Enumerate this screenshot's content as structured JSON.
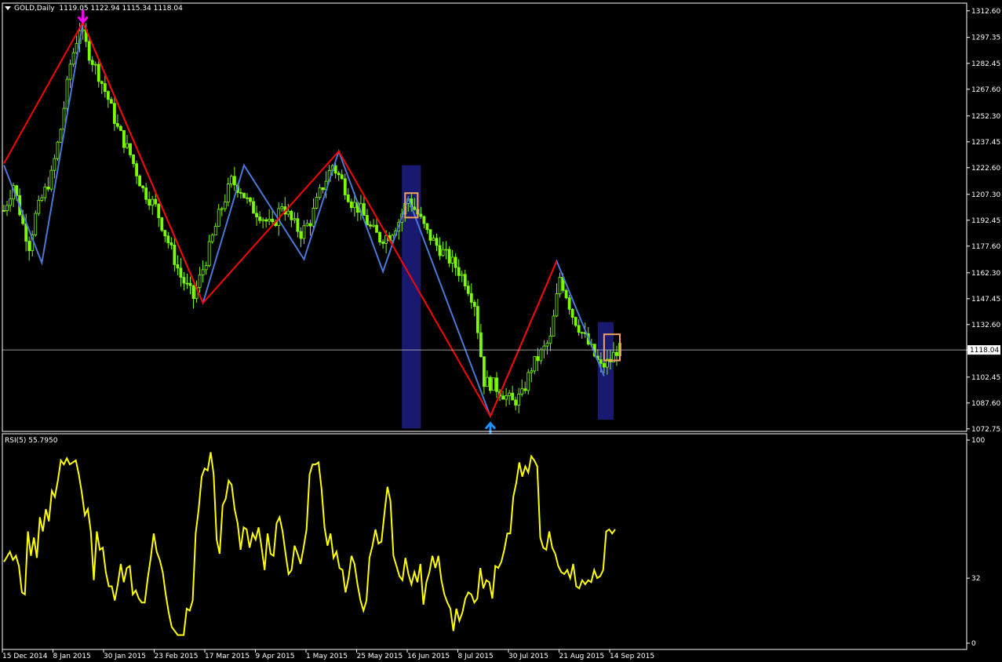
{
  "header": {
    "symbol": "GOLD,Daily",
    "ohlc": "1119.05 1122.94 1115.34 1118.04"
  },
  "rsi_header": {
    "label": "RSI(5) 55.7950"
  },
  "colors": {
    "background": "#000000",
    "grid": "#ffffff",
    "candle": "#7cfc00",
    "zigzag_major": "#ff0000",
    "zigzag_minor": "#4a78d8",
    "highlight_band": "#191970",
    "highlight_box": "#f4a460",
    "rsi_line": "#ffff00",
    "arrow_down": "#ff00ff",
    "arrow_up": "#1e90ff"
  },
  "chart_data": [
    {
      "type": "candlestick",
      "title": "GOLD,Daily",
      "ylim": [
        1071.3,
        1317.0
      ],
      "y_ticks": [
        "1312.60",
        "1297.35",
        "1282.45",
        "1267.60",
        "1252.30",
        "1237.45",
        "1222.60",
        "1207.30",
        "1192.45",
        "1177.60",
        "1162.30",
        "1147.45",
        "1132.60",
        "1118.04",
        "1102.45",
        "1087.60",
        "1072.75"
      ],
      "current_price": "1118.04",
      "x_ticks": [
        "15 Dec 2014",
        "8 Jan 2015",
        "30 Jan 2015",
        "23 Feb 2015",
        "17 Mar 2015",
        "9 Apr 2015",
        "1 May 2015",
        "25 May 2015",
        "16 Jun 2015",
        "8 Jul 2015",
        "30 Jul 2015",
        "21 Aug 2015",
        "14 Sep 2015"
      ],
      "x_range_bars": [
        0,
        195
      ],
      "close_path": [
        [
          0,
          1198
        ],
        [
          3,
          1213
        ],
        [
          6,
          1190
        ],
        [
          8,
          1178
        ],
        [
          10,
          1195
        ],
        [
          12,
          1205
        ],
        [
          15,
          1218
        ],
        [
          18,
          1245
        ],
        [
          21,
          1282
        ],
        [
          24,
          1303
        ],
        [
          27,
          1288
        ],
        [
          30,
          1276
        ],
        [
          33,
          1262
        ],
        [
          36,
          1245
        ],
        [
          40,
          1230
        ],
        [
          44,
          1210
        ],
        [
          48,
          1200
        ],
        [
          52,
          1180
        ],
        [
          56,
          1160
        ],
        [
          60,
          1148
        ],
        [
          64,
          1170
        ],
        [
          68,
          1195
        ],
        [
          72,
          1215
        ],
        [
          75,
          1210
        ],
        [
          78,
          1200
        ],
        [
          81,
          1196
        ],
        [
          85,
          1188
        ],
        [
          88,
          1202
        ],
        [
          91,
          1192
        ],
        [
          94,
          1185
        ],
        [
          97,
          1192
        ],
        [
          100,
          1208
        ],
        [
          104,
          1224
        ],
        [
          107,
          1215
        ],
        [
          110,
          1203
        ],
        [
          113,
          1198
        ],
        [
          116,
          1188
        ],
        [
          119,
          1182
        ],
        [
          122,
          1184
        ],
        [
          125,
          1192
        ],
        [
          128,
          1205
        ],
        [
          131,
          1196
        ],
        [
          134,
          1185
        ],
        [
          137,
          1178
        ],
        [
          140,
          1172
        ],
        [
          143,
          1166
        ],
        [
          146,
          1158
        ],
        [
          149,
          1145
        ],
        [
          152,
          1100
        ],
        [
          155,
          1098
        ],
        [
          158,
          1093
        ],
        [
          161,
          1088
        ],
        [
          164,
          1092
        ],
        [
          167,
          1108
        ],
        [
          170,
          1116
        ],
        [
          173,
          1124
        ],
        [
          176,
          1160
        ],
        [
          178,
          1150
        ],
        [
          180,
          1138
        ],
        [
          183,
          1128
        ],
        [
          186,
          1118
        ],
        [
          189,
          1108
        ],
        [
          192,
          1112
        ],
        [
          194,
          1118
        ]
      ],
      "zigzag_major": [
        [
          0,
          1225
        ],
        [
          25,
          1306
        ],
        [
          63,
          1145
        ],
        [
          106,
          1232
        ],
        [
          154,
          1080
        ],
        [
          175,
          1169
        ]
      ],
      "zigzag_minor": [
        [
          0,
          1224
        ],
        [
          12,
          1168
        ],
        [
          25,
          1306
        ],
        [
          63,
          1145
        ],
        [
          76,
          1224
        ],
        [
          95,
          1170
        ],
        [
          106,
          1232
        ],
        [
          120,
          1163
        ],
        [
          128,
          1205
        ],
        [
          154,
          1080
        ],
        [
          175,
          1169
        ],
        [
          190,
          1103
        ]
      ],
      "highlight_bands": [
        {
          "x": [
            126,
            132
          ],
          "y": [
            1073,
            1224
          ]
        },
        {
          "x": [
            188,
            193
          ],
          "y": [
            1078,
            1134
          ]
        }
      ],
      "highlight_boxes": [
        {
          "x": [
            127,
            131
          ],
          "y": [
            1194,
            1208
          ]
        },
        {
          "x": [
            190,
            195
          ],
          "y": [
            1112,
            1127
          ]
        }
      ],
      "arrows": [
        {
          "dir": "down",
          "x": 25,
          "y": 1306
        },
        {
          "dir": "up",
          "x": 154,
          "y": 1076
        }
      ]
    },
    {
      "type": "line",
      "title": "RSI(5) 55.7950",
      "ylim": [
        0,
        100
      ],
      "y_ticks": [
        "100",
        "32",
        "0"
      ],
      "x_range_bars": [
        0,
        195
      ],
      "series": [
        {
          "name": "RSI(5)",
          "values": [
            [
              0,
              40
            ],
            [
              2,
              45
            ],
            [
              3,
              41
            ],
            [
              4,
              43
            ],
            [
              5,
              38
            ],
            [
              6,
              25
            ],
            [
              7,
              24
            ],
            [
              8,
              55
            ],
            [
              9,
              43
            ],
            [
              10,
              52
            ],
            [
              11,
              42
            ],
            [
              12,
              62
            ],
            [
              13,
              55
            ],
            [
              14,
              66
            ],
            [
              15,
              60
            ],
            [
              16,
              75
            ],
            [
              17,
              72
            ],
            [
              18,
              80
            ],
            [
              19,
              90
            ],
            [
              20,
              88
            ],
            [
              21,
              91
            ],
            [
              22,
              88
            ],
            [
              24,
              90
            ],
            [
              25,
              83
            ],
            [
              26,
              74
            ],
            [
              27,
              63
            ],
            [
              28,
              66
            ],
            [
              29,
              55
            ],
            [
              30,
              31
            ],
            [
              31,
              55
            ],
            [
              32,
              46
            ],
            [
              33,
              47
            ],
            [
              34,
              35
            ],
            [
              35,
              28
            ],
            [
              36,
              28
            ],
            [
              37,
              21
            ],
            [
              38,
              29
            ],
            [
              39,
              39
            ],
            [
              40,
              30
            ],
            [
              41,
              37
            ],
            [
              42,
              38
            ],
            [
              43,
              24
            ],
            [
              44,
              26
            ],
            [
              45,
              22
            ],
            [
              46,
              20
            ],
            [
              47,
              20
            ],
            [
              48,
              32
            ],
            [
              49,
              42
            ],
            [
              50,
              54
            ],
            [
              51,
              45
            ],
            [
              52,
              41
            ],
            [
              53,
              35
            ],
            [
              54,
              24
            ],
            [
              55,
              15
            ],
            [
              56,
              8
            ],
            [
              57,
              6
            ],
            [
              58,
              4
            ],
            [
              59,
              4
            ],
            [
              60,
              4
            ],
            [
              61,
              17
            ],
            [
              62,
              16
            ],
            [
              63,
              21
            ],
            [
              64,
              54
            ],
            [
              65,
              66
            ],
            [
              66,
              82
            ],
            [
              67,
              86
            ],
            [
              68,
              85
            ],
            [
              69,
              94
            ],
            [
              70,
              83
            ],
            [
              71,
              51
            ],
            [
              72,
              44
            ],
            [
              73,
              68
            ],
            [
              74,
              71
            ],
            [
              75,
              80
            ],
            [
              76,
              78
            ],
            [
              77,
              66
            ],
            [
              78,
              59
            ],
            [
              79,
              46
            ],
            [
              80,
              57
            ],
            [
              81,
              56
            ],
            [
              82,
              47
            ],
            [
              83,
              54
            ],
            [
              84,
              51
            ],
            [
              85,
              57
            ],
            [
              86,
              47
            ],
            [
              87,
              36
            ],
            [
              88,
              54
            ],
            [
              89,
              44
            ],
            [
              90,
              43
            ],
            [
              91,
              59
            ],
            [
              92,
              62
            ],
            [
              93,
              55
            ],
            [
              94,
              44
            ],
            [
              95,
              34
            ],
            [
              96,
              36
            ],
            [
              97,
              48
            ],
            [
              98,
              44
            ],
            [
              99,
              39
            ],
            [
              100,
              47
            ],
            [
              101,
              56
            ],
            [
              102,
              83
            ],
            [
              103,
              88
            ],
            [
              104,
              88
            ],
            [
              105,
              89
            ],
            [
              106,
              76
            ],
            [
              107,
              57
            ],
            [
              108,
              48
            ],
            [
              109,
              54
            ],
            [
              110,
              42
            ],
            [
              111,
              45
            ],
            [
              112,
              37
            ],
            [
              113,
              36
            ],
            [
              114,
              25
            ],
            [
              115,
              32
            ],
            [
              116,
              43
            ],
            [
              117,
              39
            ],
            [
              118,
              29
            ],
            [
              119,
              21
            ],
            [
              120,
              16
            ],
            [
              121,
              21
            ],
            [
              122,
              42
            ],
            [
              123,
              48
            ],
            [
              124,
              56
            ],
            [
              125,
              49
            ],
            [
              126,
              50
            ],
            [
              127,
              64
            ],
            [
              128,
              77
            ],
            [
              129,
              70
            ],
            [
              130,
              43
            ],
            [
              131,
              38
            ],
            [
              132,
              33
            ],
            [
              133,
              31
            ],
            [
              134,
              42
            ],
            [
              135,
              34
            ],
            [
              136,
              29
            ],
            [
              137,
              35
            ],
            [
              138,
              30
            ],
            [
              139,
              39
            ],
            [
              140,
              19
            ],
            [
              141,
              30
            ],
            [
              142,
              35
            ],
            [
              143,
              43
            ],
            [
              144,
              37
            ],
            [
              145,
              43
            ],
            [
              146,
              31
            ],
            [
              147,
              24
            ],
            [
              148,
              20
            ],
            [
              149,
              17
            ],
            [
              150,
              6
            ],
            [
              151,
              17
            ],
            [
              152,
              11
            ],
            [
              153,
              15
            ],
            [
              154,
              22
            ],
            [
              155,
              25
            ],
            [
              156,
              24
            ],
            [
              157,
              20
            ],
            [
              158,
              22
            ],
            [
              159,
              37
            ],
            [
              160,
              27
            ],
            [
              161,
              31
            ],
            [
              162,
              30
            ],
            [
              163,
              22
            ],
            [
              164,
              38
            ],
            [
              165,
              37
            ],
            [
              166,
              40
            ],
            [
              167,
              46
            ],
            [
              168,
              54
            ],
            [
              169,
              54
            ],
            [
              170,
              72
            ],
            [
              171,
              79
            ],
            [
              172,
              89
            ],
            [
              173,
              82
            ],
            [
              174,
              87
            ],
            [
              175,
              84
            ],
            [
              176,
              92
            ],
            [
              177,
              90
            ],
            [
              178,
              87
            ],
            [
              179,
              52
            ],
            [
              180,
              47
            ],
            [
              181,
              46
            ],
            [
              182,
              55
            ],
            [
              183,
              47
            ],
            [
              184,
              44
            ],
            [
              185,
              38
            ],
            [
              186,
              35
            ],
            [
              187,
              34
            ],
            [
              188,
              36
            ],
            [
              189,
              32
            ],
            [
              190,
              39
            ],
            [
              191,
              28
            ],
            [
              192,
              27
            ],
            [
              193,
              31
            ],
            [
              194,
              29
            ],
            [
              195,
              31
            ],
            [
              196,
              30
            ],
            [
              197,
              36
            ],
            [
              198,
              32
            ],
            [
              199,
              33
            ],
            [
              200,
              36
            ],
            [
              201,
              55
            ],
            [
              202,
              56
            ],
            [
              203,
              54
            ],
            [
              204,
              56
            ]
          ]
        }
      ]
    }
  ]
}
